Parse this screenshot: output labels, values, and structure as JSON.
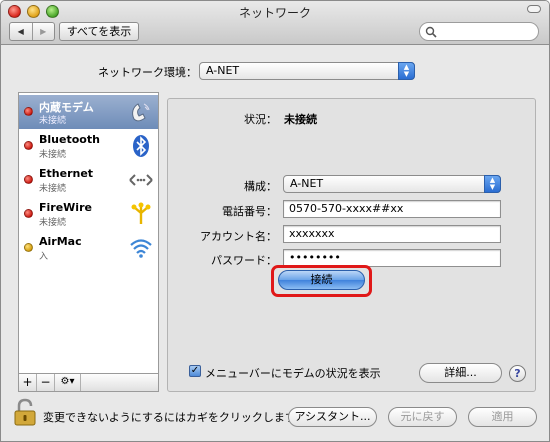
{
  "window": {
    "title": "ネットワーク"
  },
  "toolbar": {
    "back": "◀",
    "forward": "▶",
    "show_all": "すべてを表示",
    "search_placeholder": ""
  },
  "location": {
    "label": "ネットワーク環境：",
    "value": "A-NET"
  },
  "services": [
    {
      "name": "内蔵モデム",
      "status": "未接続",
      "dot": "red",
      "icon": "modem-phone-icon"
    },
    {
      "name": "Bluetooth",
      "status": "未接続",
      "dot": "red",
      "icon": "bluetooth-icon"
    },
    {
      "name": "Ethernet",
      "status": "未接続",
      "dot": "red",
      "icon": "ethernet-icon"
    },
    {
      "name": "FireWire",
      "status": "未接続",
      "dot": "red",
      "icon": "firewire-icon"
    },
    {
      "name": "AirMac",
      "status": "入",
      "dot": "yellow",
      "icon": "airmac-wifi-icon"
    }
  ],
  "sidebar_buttons": {
    "add": "+",
    "remove": "−",
    "action": "⚙▾"
  },
  "detail": {
    "status_label": "状況：",
    "status_value": "未接続",
    "config_label": "構成：",
    "config_value": "A-NET",
    "phone_label": "電話番号：",
    "phone_value": "0570-570-xxxx##xx",
    "account_label": "アカウント名：",
    "account_value": "xxxxxxx",
    "password_label": "パスワード：",
    "password_value": "••••••••",
    "connect_button": "接続",
    "show_status_label": "メニューバーにモデムの状況を表示",
    "advanced_button": "詳細...",
    "help": "?"
  },
  "footer": {
    "lock_text": "変更できないようにするにはカギをクリックします。",
    "assistant_button": "アシスタント...",
    "revert_button": "元に戻す",
    "apply_button": "適用"
  },
  "colors": {
    "selection": "#7d97c0",
    "highlight": "#e01818",
    "accent": "#3f82dc"
  }
}
